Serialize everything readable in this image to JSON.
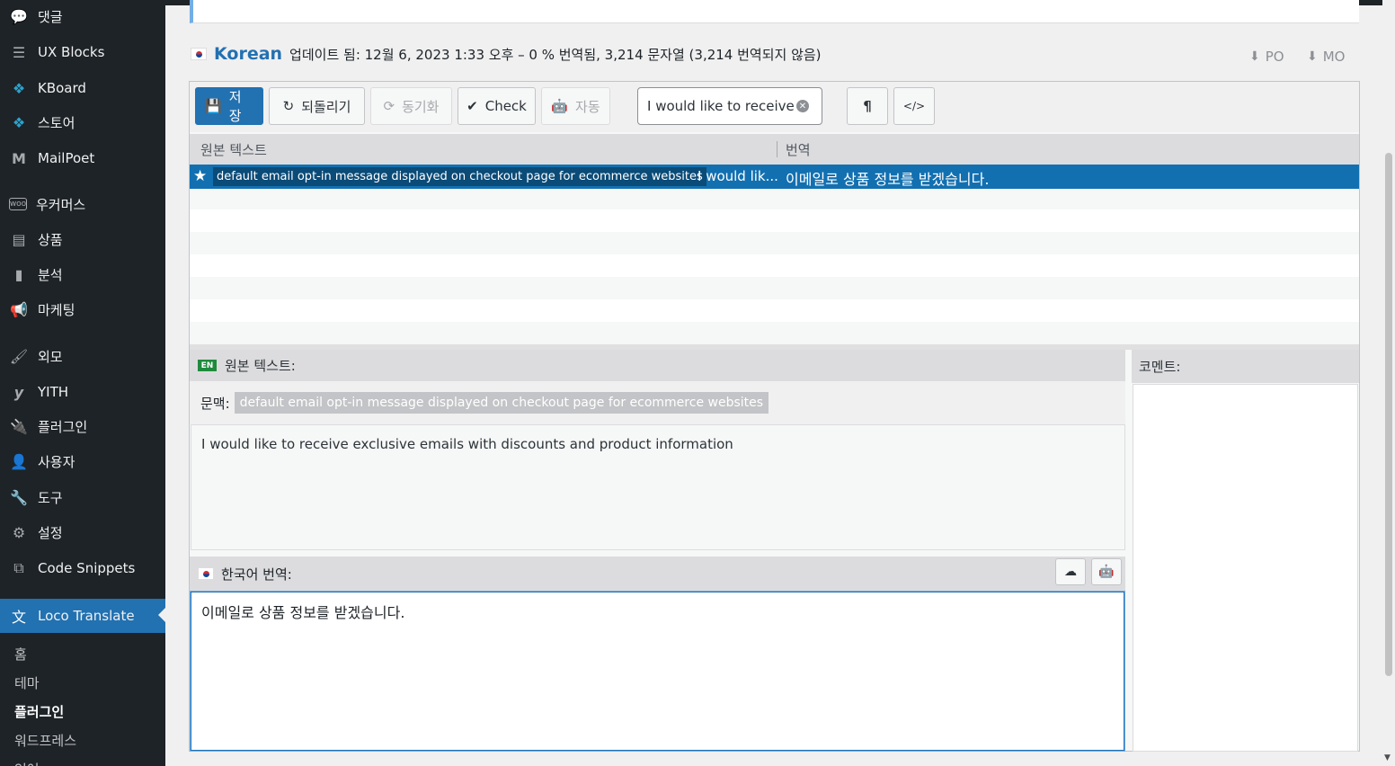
{
  "sidebar": {
    "items": [
      {
        "label": "댓글",
        "icon": "comment-icon"
      },
      {
        "label": "UX Blocks",
        "icon": "blocks-icon"
      },
      {
        "label": "KBoard",
        "icon": "kboard-icon"
      },
      {
        "label": "스토어",
        "icon": "store-icon"
      },
      {
        "label": "MailPoet",
        "icon": "mailpoet-icon"
      },
      {
        "label": "우커머스",
        "icon": "woo-icon"
      },
      {
        "label": "상품",
        "icon": "archive-icon"
      },
      {
        "label": "분석",
        "icon": "chart-icon"
      },
      {
        "label": "마케팅",
        "icon": "megaphone-icon"
      },
      {
        "label": "외모",
        "icon": "brush-icon"
      },
      {
        "label": "YITH",
        "icon": "yith-icon"
      },
      {
        "label": "플러그인",
        "icon": "plugin-icon"
      },
      {
        "label": "사용자",
        "icon": "user-icon"
      },
      {
        "label": "도구",
        "icon": "wrench-icon"
      },
      {
        "label": "설정",
        "icon": "settings-icon"
      },
      {
        "label": "Code Snippets",
        "icon": "code-icon"
      },
      {
        "label": "Loco Translate",
        "icon": "translate-icon"
      }
    ],
    "submenu": [
      "홈",
      "테마",
      "플러그인",
      "워드프레스",
      "언어"
    ]
  },
  "heading": {
    "language": "Korean",
    "stats": "업데이트 됨: 12월 6, 2023 1:33 오후 – 0 % 번역됨, 3,214 문자열 (3,214 번역되지 않음)",
    "po_label": "PO",
    "mo_label": "MO"
  },
  "toolbar": {
    "save": "저장",
    "revert": "되돌리기",
    "sync": "동기화",
    "check": "Check",
    "auto": "자동",
    "search_value": "I would like to receive exclusive emails",
    "pilcrow": "¶",
    "code": "</>"
  },
  "list": {
    "col_source": "원본 텍스트",
    "col_target": "번역",
    "selected": {
      "context": "default email opt-in message displayed on checkout page for ecommerce websites",
      "source": "I would lik...",
      "target": "이메일로 상품 정보를 받겠습니다."
    }
  },
  "source_panel": {
    "badge": "EN",
    "title": "원본 텍스트:",
    "context_label": "문맥:",
    "context": "default email opt-in message displayed on checkout page for ecommerce websites",
    "text": "I would like to receive exclusive emails with discounts and product information"
  },
  "target_panel": {
    "title": "한국어 번역:",
    "text": "이메일로 상품 정보를 받겠습니다."
  },
  "comments": {
    "title": "코멘트:"
  },
  "colors": {
    "accent": "#2271b1",
    "selected_row": "#1270b1",
    "sidebar_bg": "#1d2327"
  }
}
